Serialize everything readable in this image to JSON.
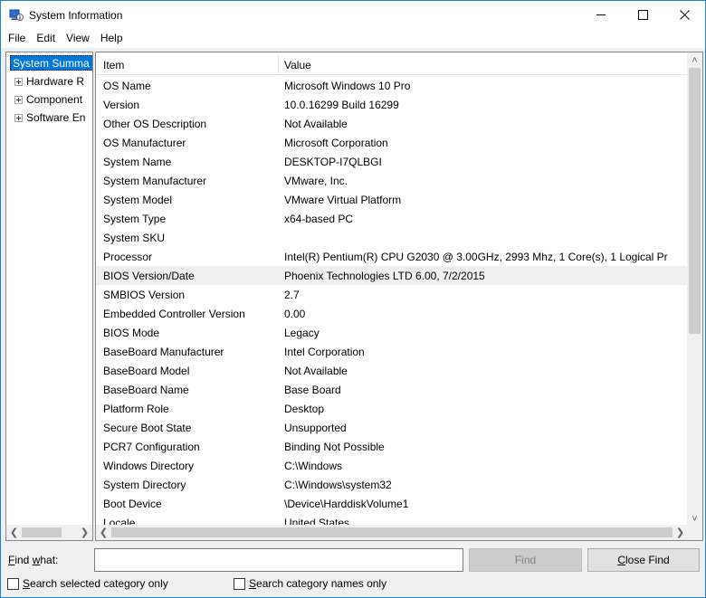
{
  "window": {
    "title": "System Information"
  },
  "menu": [
    "File",
    "Edit",
    "View",
    "Help"
  ],
  "tree": {
    "selected": "System Summa",
    "items": [
      "Hardware R",
      "Component",
      "Software En"
    ]
  },
  "table": {
    "headers": {
      "item": "Item",
      "value": "Value"
    },
    "rows": [
      {
        "item": "OS Name",
        "value": "Microsoft Windows 10 Pro"
      },
      {
        "item": "Version",
        "value": "10.0.16299 Build 16299"
      },
      {
        "item": "Other OS Description",
        "value": "Not Available"
      },
      {
        "item": "OS Manufacturer",
        "value": "Microsoft Corporation"
      },
      {
        "item": "System Name",
        "value": "DESKTOP-I7QLBGI"
      },
      {
        "item": "System Manufacturer",
        "value": "VMware, Inc."
      },
      {
        "item": "System Model",
        "value": "VMware Virtual Platform"
      },
      {
        "item": "System Type",
        "value": "x64-based PC"
      },
      {
        "item": "System SKU",
        "value": ""
      },
      {
        "item": "Processor",
        "value": "Intel(R) Pentium(R) CPU G2030 @ 3.00GHz, 2993 Mhz, 1 Core(s), 1 Logical Pr"
      },
      {
        "item": "BIOS Version/Date",
        "value": "Phoenix Technologies LTD 6.00, 7/2/2015"
      },
      {
        "item": "SMBIOS Version",
        "value": "2.7"
      },
      {
        "item": "Embedded Controller Version",
        "value": "0.00"
      },
      {
        "item": "BIOS Mode",
        "value": "Legacy"
      },
      {
        "item": "BaseBoard Manufacturer",
        "value": "Intel Corporation"
      },
      {
        "item": "BaseBoard Model",
        "value": "Not Available"
      },
      {
        "item": "BaseBoard Name",
        "value": "Base Board"
      },
      {
        "item": "Platform Role",
        "value": "Desktop"
      },
      {
        "item": "Secure Boot State",
        "value": "Unsupported"
      },
      {
        "item": "PCR7 Configuration",
        "value": "Binding Not Possible"
      },
      {
        "item": "Windows Directory",
        "value": "C:\\Windows"
      },
      {
        "item": "System Directory",
        "value": "C:\\Windows\\system32"
      },
      {
        "item": "Boot Device",
        "value": "\\Device\\HarddiskVolume1"
      },
      {
        "item": "Locale",
        "value": "United States"
      }
    ],
    "highlighted_index": 10
  },
  "find": {
    "label_accel": "F",
    "label_rest_1": "ind ",
    "label_accel_2": "w",
    "label_rest_2": "hat:",
    "input_value": "",
    "find_button_accel": "",
    "find_button_label": "Find",
    "close_find_accel": "C",
    "close_find_rest": "lose Find",
    "check_selected_accel": "S",
    "check_selected_rest": "earch selected category only",
    "check_names_accel": "S",
    "check_names_rest": "earch category names only"
  },
  "icons": {
    "app": "system-information-icon",
    "minimize": "minimize-icon",
    "maximize": "maximize-icon",
    "close": "close-icon"
  }
}
